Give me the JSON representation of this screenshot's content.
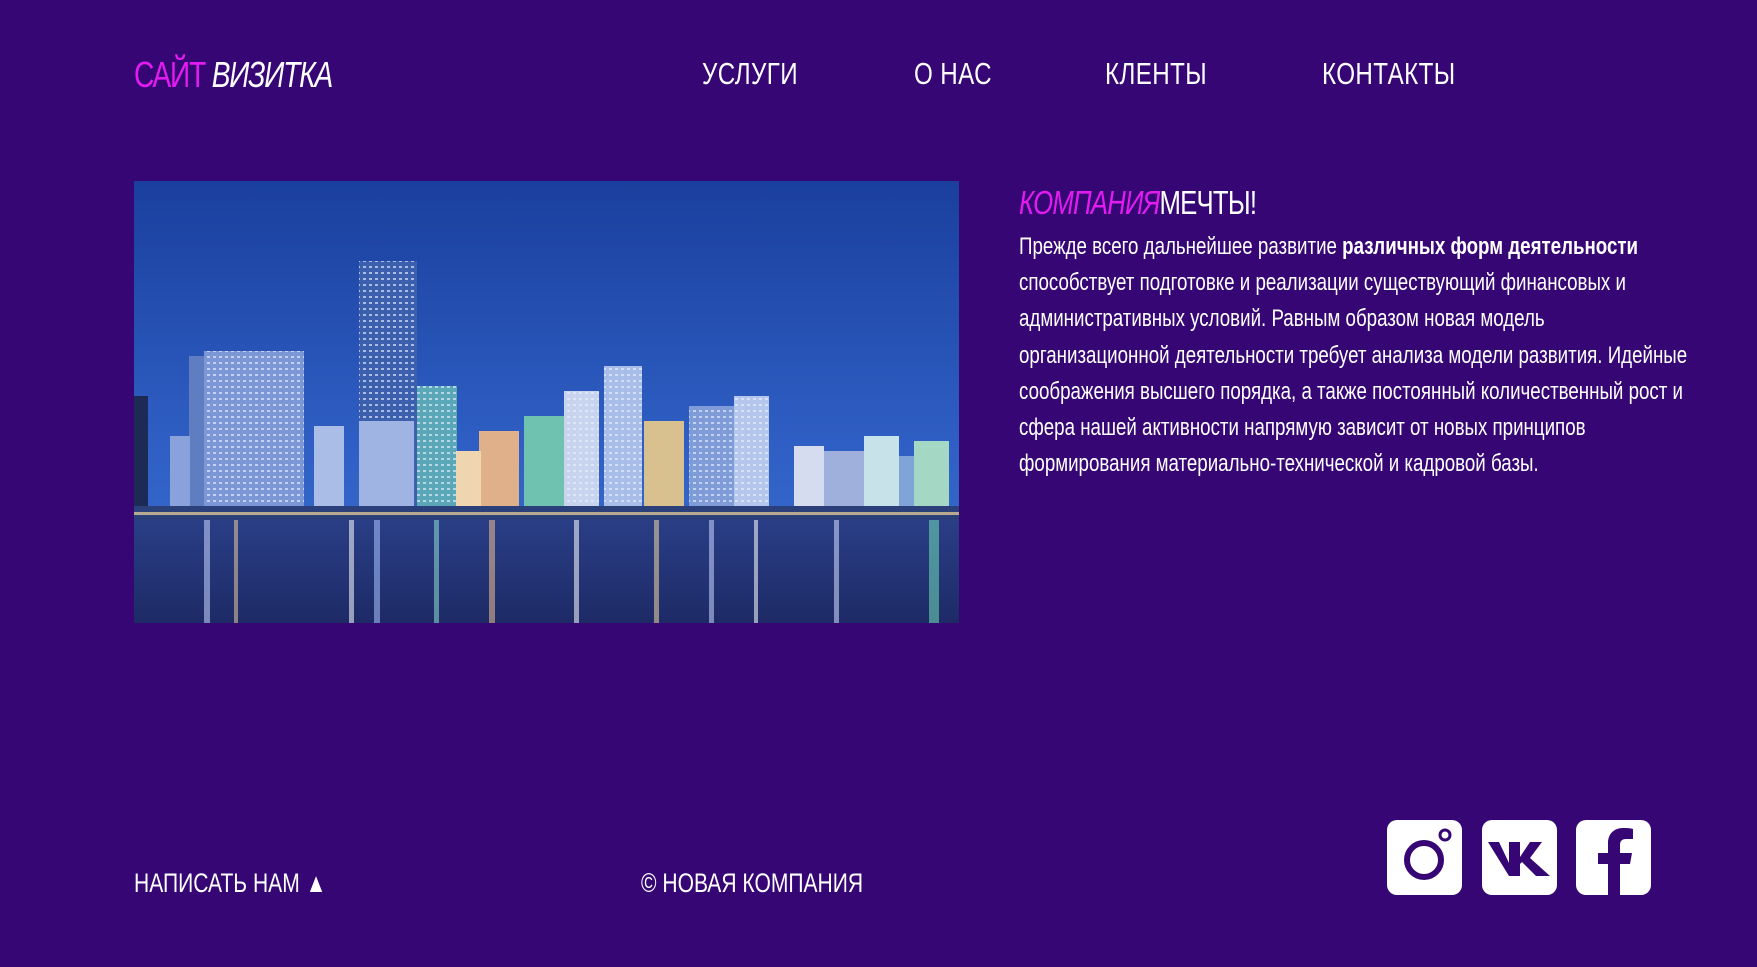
{
  "logo": {
    "part1": "САЙТ",
    "part2": "ВИЗИТКА"
  },
  "nav": {
    "items": [
      {
        "label": "УСЛУГИ"
      },
      {
        "label": "О НАС"
      },
      {
        "label": "КЛЕНТЫ"
      },
      {
        "label": "КОНТАКТЫ"
      }
    ]
  },
  "hero": {
    "icon": "city-skyline-night-image"
  },
  "content": {
    "headline_highlight": "КОМПАНИЯ",
    "headline_rest": "МЕЧТЫ!",
    "text_before": "Прежде всего дальнейшее развитие ",
    "text_bold": "различных форм деятельности",
    "text_after": " способствует подготовке и реализации существующий финансовых и административных условий. Равным образом новая модель организационной деятельности требует анализа модели развития. Идейные соображения высшего порядка, а также постоянный количественный рост и сфера нашей активности напрямую зависит от новых принципов формирования материально-технической и кадровой базы."
  },
  "footer": {
    "write_us": "НАПИСАТЬ НАМ ▲",
    "copyright": "© НОВАЯ КОМПАНИЯ",
    "social": [
      {
        "icon": "instagram-icon"
      },
      {
        "icon": "vk-icon"
      },
      {
        "icon": "facebook-icon"
      }
    ]
  },
  "colors": {
    "background": "#360675",
    "accent": "#e21cf0",
    "text": "#ffffff"
  }
}
